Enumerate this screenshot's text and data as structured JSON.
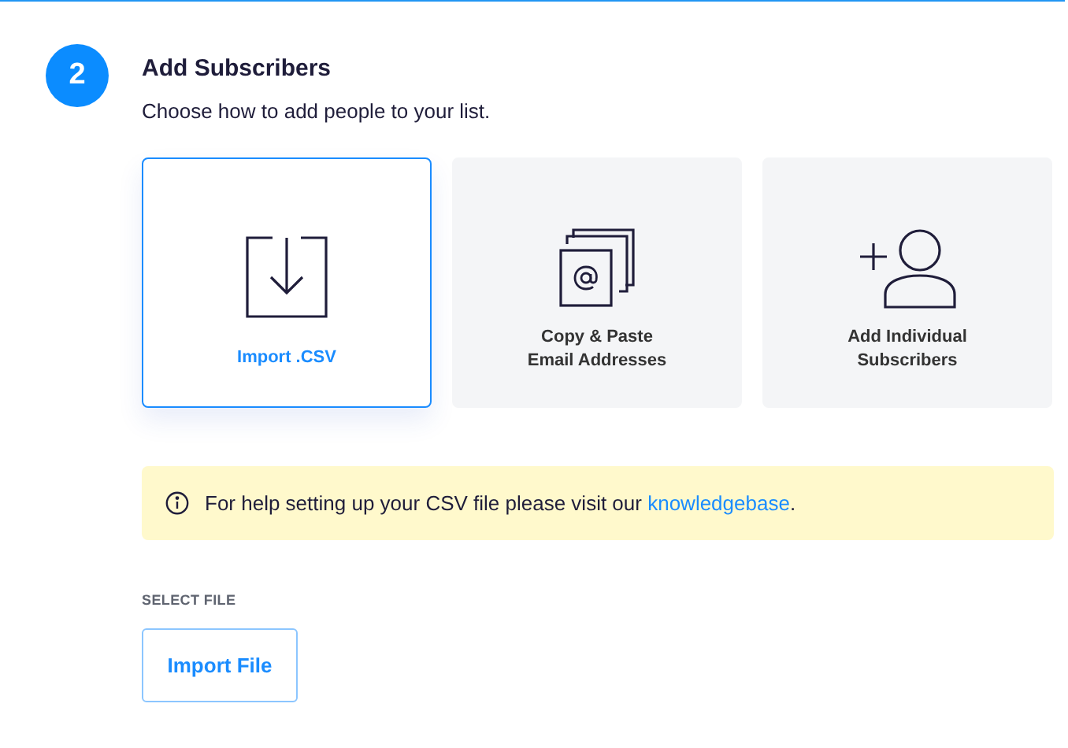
{
  "step": {
    "number": "2",
    "title": "Add Subscribers",
    "subtitle": "Choose how to add people to your list."
  },
  "options": [
    {
      "kind": "import",
      "label": "Import .CSV",
      "selected": true
    },
    {
      "kind": "paste",
      "label": "Copy & Paste\nEmail Addresses",
      "selected": false
    },
    {
      "kind": "individual",
      "label": "Add Individual\nSubscribers",
      "selected": false
    }
  ],
  "notice": {
    "text": "For help setting up your CSV file please visit our ",
    "link": "knowledgebase",
    "after": "."
  },
  "select_file": {
    "label": "SELECT FILE",
    "button": "Import File"
  }
}
